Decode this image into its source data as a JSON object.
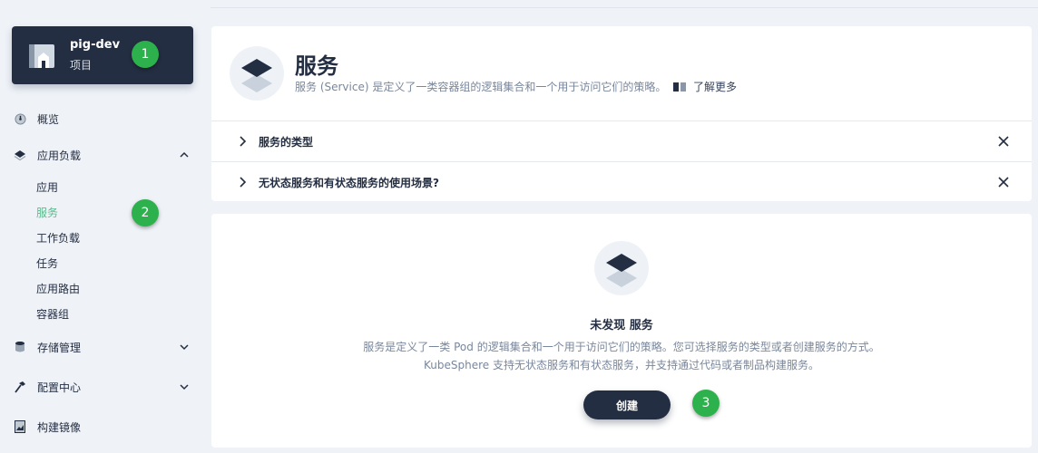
{
  "project": {
    "name": "pig-dev",
    "type": "项目"
  },
  "badges": [
    "1",
    "2",
    "3"
  ],
  "sidebar": {
    "overview": "概览",
    "workloads": {
      "label": "应用负载",
      "items": [
        "应用",
        "服务",
        "工作负载",
        "任务",
        "应用路由",
        "容器组"
      ],
      "active": "服务"
    },
    "storage": "存储管理",
    "config": "配置中心",
    "image_build": "构建镜像"
  },
  "header": {
    "title": "服务",
    "description": "服务 (Service) 是定义了一类容器组的逻辑集合和一个用于访问它们的策略。",
    "learn_more": "了解更多",
    "faq": [
      "服务的类型",
      "无状态服务和有状态服务的使用场景?"
    ]
  },
  "empty": {
    "title": "未发现 服务",
    "line1": "服务是定义了一类 Pod 的逻辑集合和一个用于访问它们的策略。您可选择服务的类型或者创建服务的方式。",
    "line2": "KubeSphere 支持无状态服务和有状态服务，并支持通过代码或者制品构建服务。",
    "create_label": "创建"
  },
  "colors": {
    "dark": "#242e42",
    "active": "#55bc8a",
    "badge": "#2db14c",
    "link": "#3385ff"
  }
}
